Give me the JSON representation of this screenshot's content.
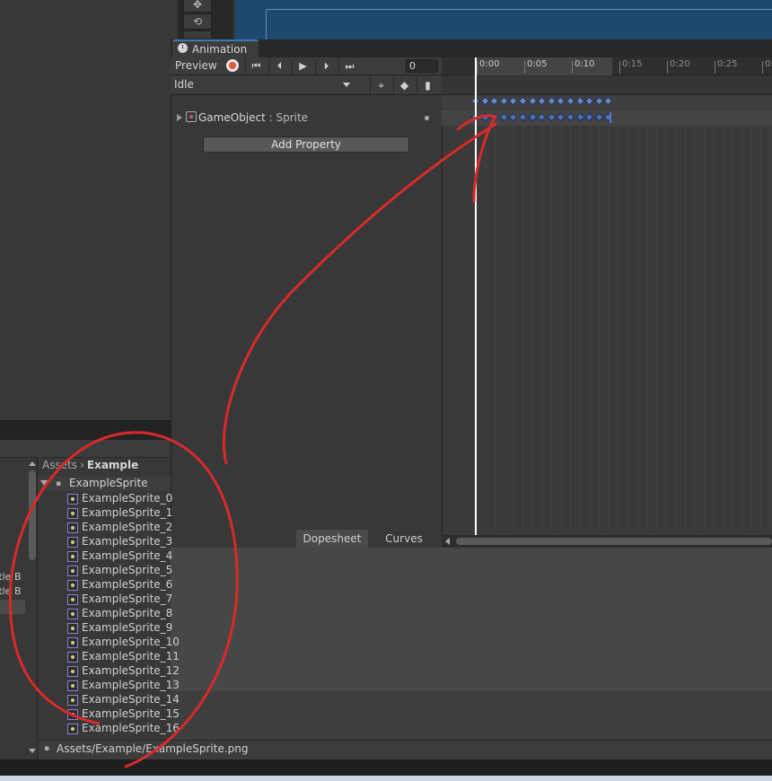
{
  "scene": {
    "tool_icons": [
      "move-icon",
      "rotate-icon",
      "rect-icon"
    ]
  },
  "animation": {
    "tab_title": "Animation",
    "preview_label": "Preview",
    "frame_value": "0",
    "clip_name": "Idle",
    "property_label_object": "GameObject",
    "property_label_sep": " : ",
    "property_label_name": "Sprite",
    "add_property_label": "Add Property",
    "dopesheet_tab": "Dopesheet",
    "curves_tab": "Curves",
    "ruler_ticks": [
      "0:00",
      "0:05",
      "0:10",
      "0:15",
      "0:20",
      "0:25",
      "0:"
    ],
    "keyframe_count": 15
  },
  "project": {
    "side_items": [
      "ttle B",
      "ttle B"
    ],
    "breadcrumb_root": "Assets",
    "breadcrumb_folder": "Example",
    "group_name": "ExampleSprite",
    "sprites": [
      "ExampleSprite_0",
      "ExampleSprite_1",
      "ExampleSprite_2",
      "ExampleSprite_3",
      "ExampleSprite_4",
      "ExampleSprite_5",
      "ExampleSprite_6",
      "ExampleSprite_7",
      "ExampleSprite_8",
      "ExampleSprite_9",
      "ExampleSprite_10",
      "ExampleSprite_11",
      "ExampleSprite_12",
      "ExampleSprite_13",
      "ExampleSprite_14",
      "ExampleSprite_15",
      "ExampleSprite_16"
    ],
    "status_path": "Assets/Example/ExampleSprite.png"
  },
  "colors": {
    "annotation": "#d92a2a",
    "keyframe": "#6a88c6",
    "scene_bg": "#1d4a6e"
  }
}
